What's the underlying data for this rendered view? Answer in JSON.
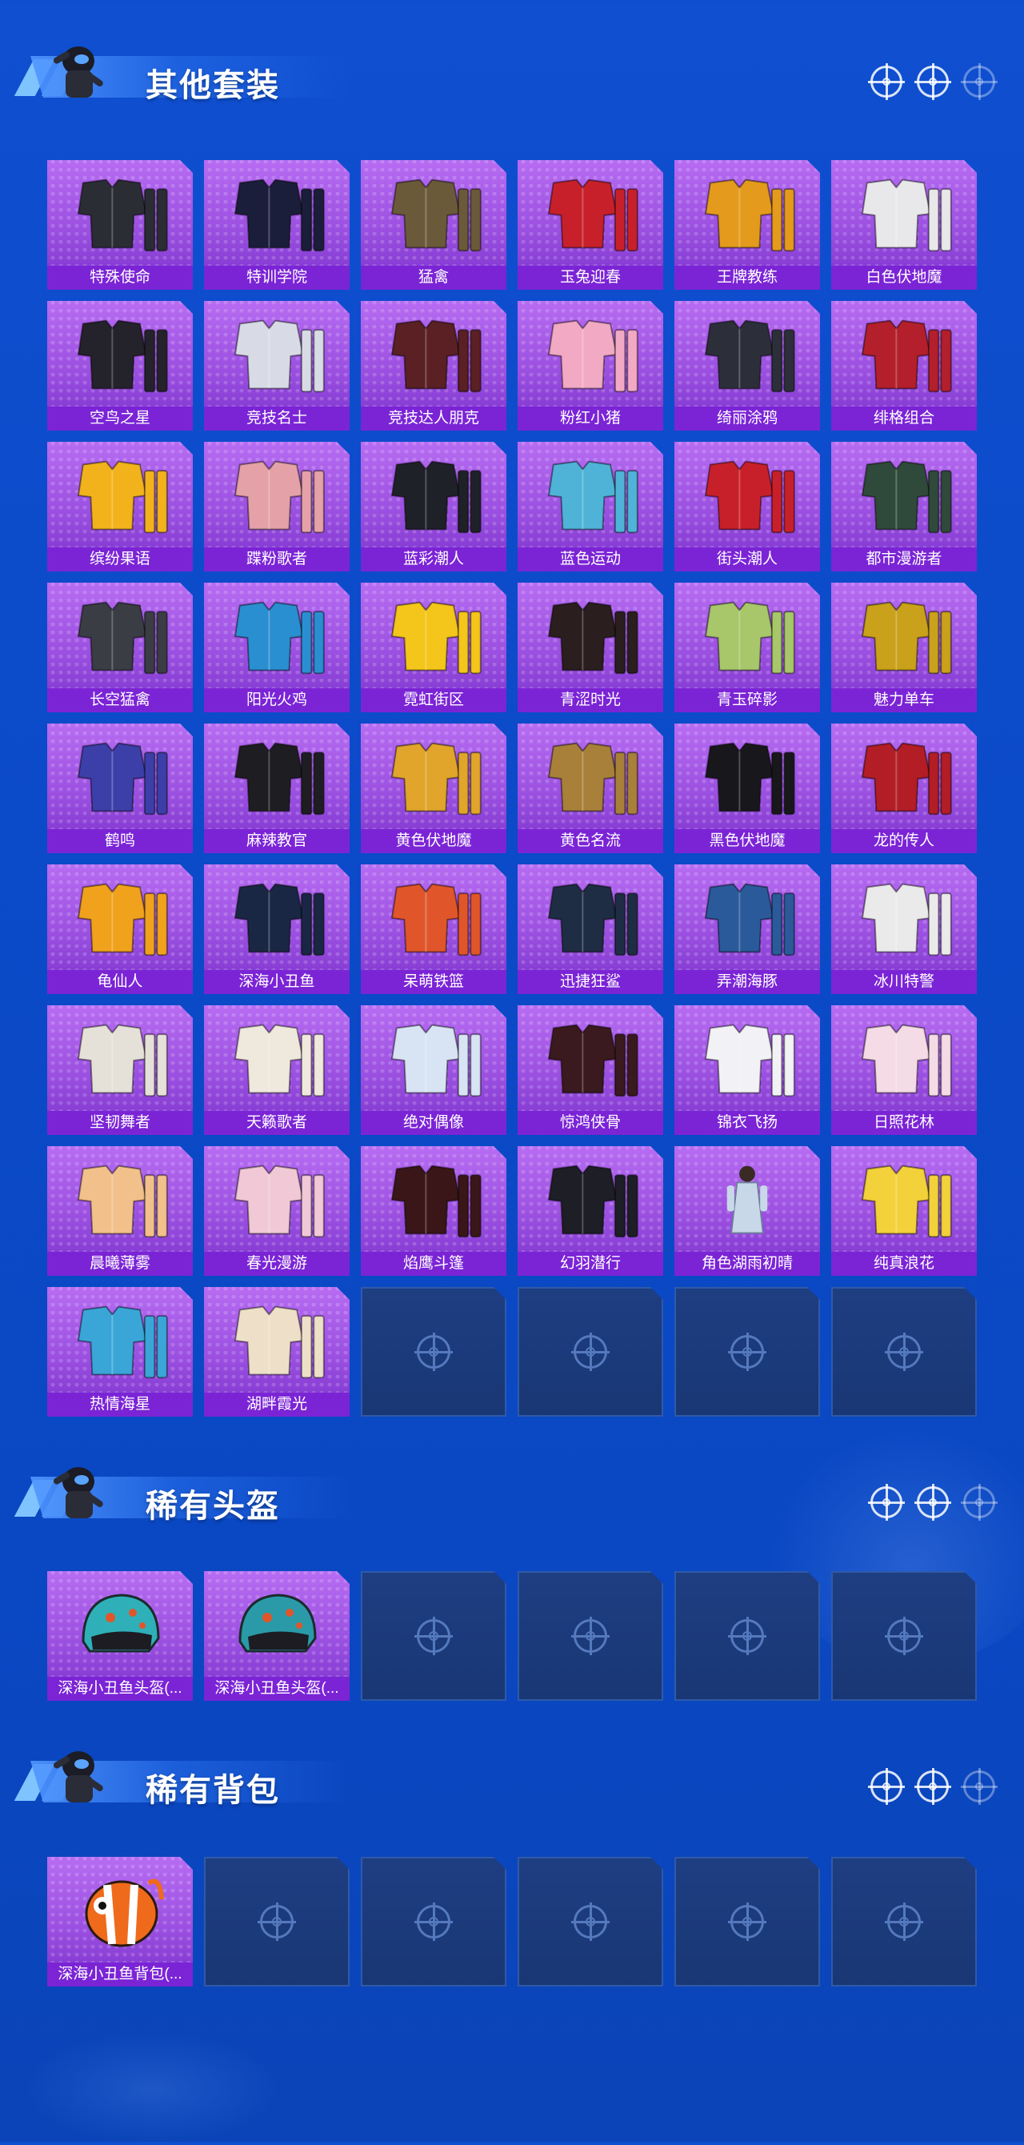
{
  "colors": {
    "background": "#0b4ac8",
    "card_purple": "#9a4fe0",
    "label_bar": "#7b24d6",
    "empty_card": "#1c3a7b"
  },
  "sections": [
    {
      "title": "其他套装",
      "items": [
        {
          "label": "特殊使命",
          "icon": "outfit-icon",
          "tone": "#2a2d34"
        },
        {
          "label": "特训学院",
          "icon": "outfit-icon",
          "tone": "#1b1e3a"
        },
        {
          "label": "猛禽",
          "icon": "outfit-icon",
          "tone": "#6b5a3a"
        },
        {
          "label": "玉兔迎春",
          "icon": "outfit-icon",
          "tone": "#c8202a"
        },
        {
          "label": "王牌教练",
          "icon": "outfit-icon",
          "tone": "#e49a1c"
        },
        {
          "label": "白色伏地魔",
          "icon": "outfit-icon",
          "tone": "#e8e8ea"
        },
        {
          "label": "空鸟之星",
          "icon": "outfit-icon",
          "tone": "#24222b"
        },
        {
          "label": "竞技名士",
          "icon": "outfit-icon",
          "tone": "#d8dbe6"
        },
        {
          "label": "竞技达人朋克",
          "icon": "outfit-icon",
          "tone": "#5a2024"
        },
        {
          "label": "粉红小猪",
          "icon": "outfit-icon",
          "tone": "#f2a9c4"
        },
        {
          "label": "绮丽涂鸦",
          "icon": "outfit-icon",
          "tone": "#2c2f3a"
        },
        {
          "label": "绯格组合",
          "icon": "outfit-icon",
          "tone": "#b31f2b"
        },
        {
          "label": "缤纷果语",
          "icon": "outfit-icon",
          "tone": "#f2b21b"
        },
        {
          "label": "蹀粉歌者",
          "icon": "outfit-icon",
          "tone": "#e4a1a8"
        },
        {
          "label": "蓝彩潮人",
          "icon": "outfit-icon",
          "tone": "#1f2128"
        },
        {
          "label": "蓝色运动",
          "icon": "outfit-icon",
          "tone": "#4fb3d8"
        },
        {
          "label": "街头潮人",
          "icon": "outfit-icon",
          "tone": "#c8202a"
        },
        {
          "label": "都市漫游者",
          "icon": "outfit-icon",
          "tone": "#2f4a3a"
        },
        {
          "label": "长空猛禽",
          "icon": "outfit-icon",
          "tone": "#3a3d44"
        },
        {
          "label": "阳光火鸡",
          "icon": "outfit-icon",
          "tone": "#2a8fd0"
        },
        {
          "label": "霓虹街区",
          "icon": "outfit-icon",
          "tone": "#f4c51a"
        },
        {
          "label": "青涩时光",
          "icon": "outfit-icon",
          "tone": "#2a1e1e"
        },
        {
          "label": "青玉碎影",
          "icon": "outfit-icon",
          "tone": "#a8c66a"
        },
        {
          "label": "魅力单车",
          "icon": "outfit-icon",
          "tone": "#c9a11a"
        },
        {
          "label": "鹤鸣",
          "icon": "outfit-icon",
          "tone": "#3c3fa8"
        },
        {
          "label": "麻辣教官",
          "icon": "outfit-icon",
          "tone": "#1e1e22"
        },
        {
          "label": "黄色伏地魔",
          "icon": "outfit-icon",
          "tone": "#e0a52a"
        },
        {
          "label": "黄色名流",
          "icon": "outfit-icon",
          "tone": "#a8803a"
        },
        {
          "label": "黑色伏地魔",
          "icon": "outfit-icon",
          "tone": "#18181c"
        },
        {
          "label": "龙的传人",
          "icon": "outfit-icon",
          "tone": "#b21d26"
        },
        {
          "label": "龟仙人",
          "icon": "outfit-icon",
          "tone": "#f0a21c"
        },
        {
          "label": "深海小丑鱼",
          "icon": "outfit-icon",
          "tone": "#1a2744"
        },
        {
          "label": "呆萌铁篮",
          "icon": "outfit-icon",
          "tone": "#e0562a"
        },
        {
          "label": "迅捷狂鲨",
          "icon": "outfit-icon",
          "tone": "#1e2d44"
        },
        {
          "label": "弄潮海豚",
          "icon": "outfit-icon",
          "tone": "#2a5a9a"
        },
        {
          "label": "冰川特警",
          "icon": "outfit-icon",
          "tone": "#eaeaea"
        },
        {
          "label": "坚韧舞者",
          "icon": "outfit-icon",
          "tone": "#e6e1d8"
        },
        {
          "label": "天籁歌者",
          "icon": "outfit-icon",
          "tone": "#efe8dc"
        },
        {
          "label": "绝对偶像",
          "icon": "outfit-icon",
          "tone": "#d8e4f4"
        },
        {
          "label": "惊鸿侠骨",
          "icon": "outfit-icon",
          "tone": "#3a1a1e"
        },
        {
          "label": "锦衣飞扬",
          "icon": "outfit-icon",
          "tone": "#f2f2f6"
        },
        {
          "label": "日照花林",
          "icon": "outfit-icon",
          "tone": "#f4dbe6"
        },
        {
          "label": "晨曦薄雾",
          "icon": "outfit-icon",
          "tone": "#f2c08a"
        },
        {
          "label": "春光漫游",
          "icon": "outfit-icon",
          "tone": "#f1c8d6"
        },
        {
          "label": "焰鹰斗篷",
          "icon": "outfit-icon",
          "tone": "#3a1618"
        },
        {
          "label": "幻羽潜行",
          "icon": "outfit-icon",
          "tone": "#1d1e26"
        },
        {
          "label": "角色湖雨初晴",
          "icon": "character-icon",
          "tone": "#c8d8e8"
        },
        {
          "label": "纯真浪花",
          "icon": "outfit-icon",
          "tone": "#f2d13a"
        },
        {
          "label": "热情海星",
          "icon": "outfit-icon",
          "tone": "#3aa6d8"
        },
        {
          "label": "湖畔霞光",
          "icon": "outfit-icon",
          "tone": "#eee0c8"
        }
      ],
      "empty_slots": 4
    },
    {
      "title": "稀有头盔",
      "items": [
        {
          "label": "深海小丑鱼头盔(...",
          "icon": "helmet-icon",
          "tone": "#2fb0b8"
        },
        {
          "label": "深海小丑鱼头盔(...",
          "icon": "helmet-icon",
          "tone": "#2a9aa8"
        }
      ],
      "empty_slots": 4
    },
    {
      "title": "稀有背包",
      "items": [
        {
          "label": "深海小丑鱼背包(...",
          "icon": "backpack-icon",
          "tone": "#f06a1c"
        }
      ],
      "empty_slots": 5
    }
  ]
}
